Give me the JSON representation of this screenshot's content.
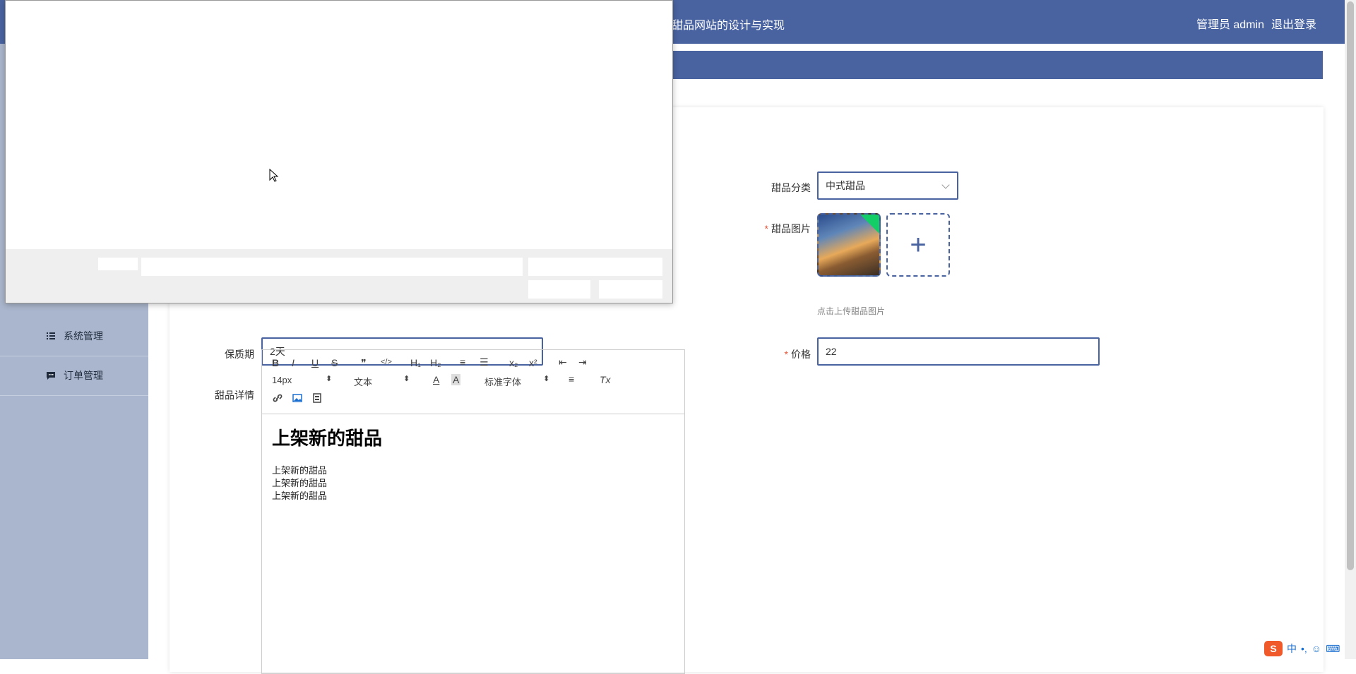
{
  "header": {
    "site_title": "甜品网站的设计与实现",
    "user_label": "管理员 admin",
    "logout_label": "退出登录"
  },
  "sidebar": {
    "items": [
      {
        "label": "系统管理",
        "icon": "list-icon"
      },
      {
        "label": "订单管理",
        "icon": "chat-icon"
      }
    ]
  },
  "form": {
    "category_label": "甜品分类",
    "category_value": "中式甜品",
    "image_label": "甜品图片",
    "image_hint": "点击上传甜品图片",
    "shelf_label": "保质期",
    "shelf_value": "2天",
    "price_label": "价格",
    "price_value": "22",
    "detail_label": "甜品详情"
  },
  "editor": {
    "toolbar": {
      "bold": "B",
      "italic": "I",
      "underline": "U",
      "strike": "S",
      "quote": "❞",
      "code": "</>",
      "h1": "H₁",
      "h2": "H₂",
      "ordered": "≡",
      "bullet": "☰",
      "sub": "x₂",
      "sup": "x²",
      "outdent": "⇤",
      "indent": "⇥",
      "size": "14px",
      "header": "文本",
      "color": "A",
      "background": "A",
      "font": "标准字体",
      "align": "≡",
      "clean": "Tx"
    },
    "heading": "上架新的甜品",
    "paragraphs": [
      "上架新的甜品",
      "上架新的甜品",
      "上架新的甜品"
    ]
  },
  "ime": {
    "logo": "S",
    "mode": "中",
    "punct": "•,",
    "emoji": "☺",
    "keyboard": "⌨"
  },
  "colors": {
    "primary": "#4963a0",
    "sidebar": "#aab6cd",
    "required": "#e0563a",
    "success": "#13ce66"
  }
}
